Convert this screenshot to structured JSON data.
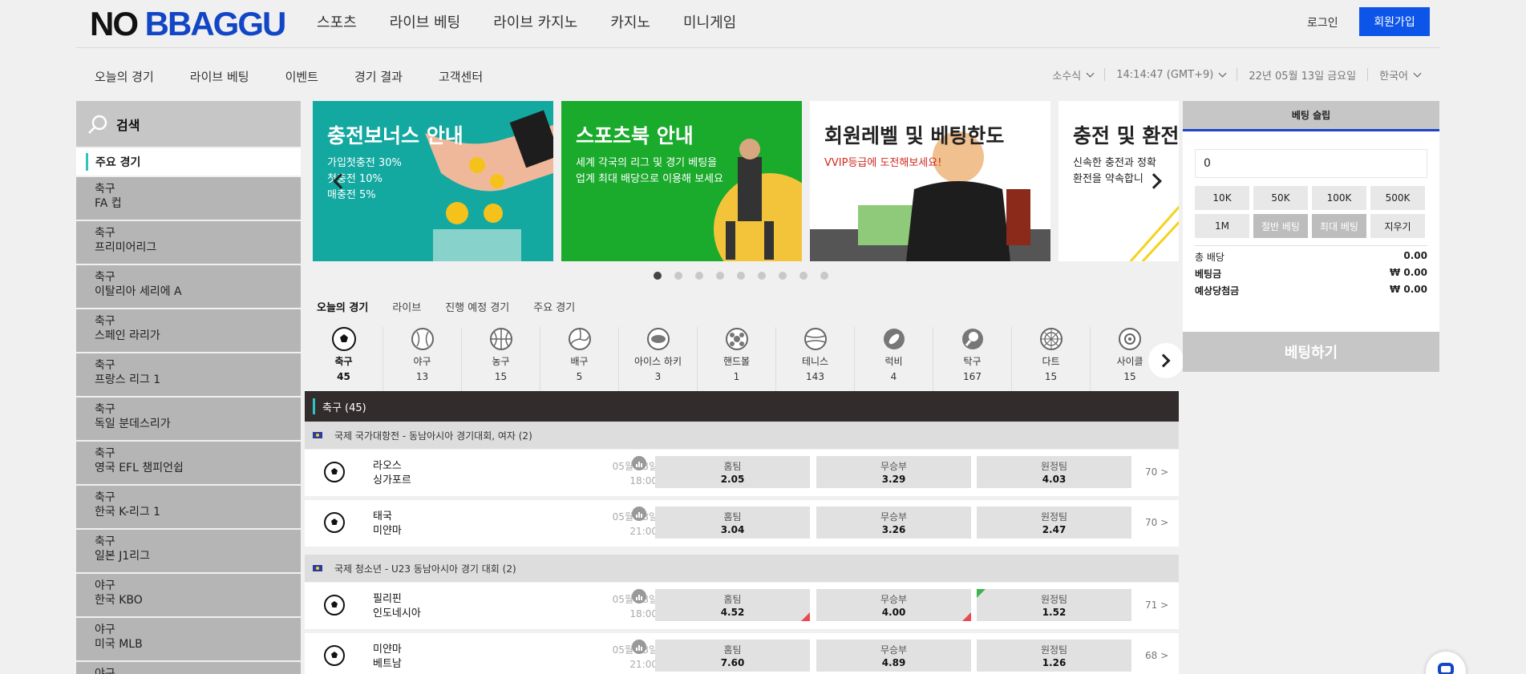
{
  "header": {
    "logo_part1": "NO",
    "logo_part2": "BBAGGU",
    "nav": [
      "스포츠",
      "라이브 베팅",
      "라이브 카지노",
      "카지노",
      "미니게임"
    ],
    "login": "로그인",
    "signup": "회원가입"
  },
  "subnav": {
    "items": [
      "오늘의 경기",
      "라이브 베팅",
      "이벤트",
      "경기 결과",
      "고객센터"
    ],
    "odds_format": "소수식",
    "time": "14:14:47 (GMT+9)",
    "date": "22년 05월 13일 금요일",
    "language": "한국어"
  },
  "sidebar": {
    "search": "검색",
    "title": "주요 경기",
    "items": [
      {
        "sport": "축구",
        "league": "FA 컵"
      },
      {
        "sport": "축구",
        "league": "프리미어리그"
      },
      {
        "sport": "축구",
        "league": "이탈리아 세리에 A"
      },
      {
        "sport": "축구",
        "league": "스페인 라리가"
      },
      {
        "sport": "축구",
        "league": "프랑스 리그 1"
      },
      {
        "sport": "축구",
        "league": "독일 분데스리가"
      },
      {
        "sport": "축구",
        "league": "영국 EFL 챔피언쉽"
      },
      {
        "sport": "축구",
        "league": "한국 K-리그 1"
      },
      {
        "sport": "축구",
        "league": "일본 J1리그"
      },
      {
        "sport": "야구",
        "league": "한국 KBO"
      },
      {
        "sport": "야구",
        "league": "미국 MLB"
      },
      {
        "sport": "야구",
        "league": ""
      }
    ]
  },
  "banners": [
    {
      "title": "충전보너스 안내",
      "lines": [
        "가입첫충전 30%",
        "첫충전 10%",
        "매충전 5%"
      ],
      "bg": "#13a8a0"
    },
    {
      "title": "스포츠북 안내",
      "lines": [
        "세계 각국의 리그 및 경기 베팅을",
        "업계 최대 배당으로 이용해 보세요"
      ],
      "bg": "#1aaa2c"
    },
    {
      "title": "회원레벨 및 베팅한도",
      "lines": [
        "VVIP등급에 도전해보세요!"
      ],
      "bg": "#ffffff"
    },
    {
      "title": "충전 및 환전",
      "lines": [
        "신속한 충전과 정확",
        "환전을 약속합니"
      ],
      "bg": "#ffffff"
    }
  ],
  "tabs": [
    "오늘의 경기",
    "라이브",
    "진행 예정 경기",
    "주요 경기"
  ],
  "sports": [
    {
      "name": "축구",
      "count": "45",
      "icon": "soccer-icon"
    },
    {
      "name": "야구",
      "count": "13",
      "icon": "baseball-icon"
    },
    {
      "name": "농구",
      "count": "15",
      "icon": "basketball-icon"
    },
    {
      "name": "배구",
      "count": "5",
      "icon": "volleyball-icon"
    },
    {
      "name": "아이스 하키",
      "count": "3",
      "icon": "hockey-icon"
    },
    {
      "name": "핸드볼",
      "count": "1",
      "icon": "handball-icon"
    },
    {
      "name": "테니스",
      "count": "143",
      "icon": "tennis-icon"
    },
    {
      "name": "럭비",
      "count": "4",
      "icon": "rugby-icon"
    },
    {
      "name": "탁구",
      "count": "167",
      "icon": "table-tennis-icon"
    },
    {
      "name": "다트",
      "count": "15",
      "icon": "darts-icon"
    },
    {
      "name": "사이클",
      "count": "15",
      "icon": "cycling-icon"
    }
  ],
  "section_title": "축구 (45)",
  "leagues": [
    {
      "name": "국제 국가대항전 - 동남아시아 경기대회, 여자 (2)",
      "matches": [
        {
          "home": "라오스",
          "away": "싱가포르",
          "date": "05월 13일",
          "time": "18:00",
          "odds": [
            "2.05",
            "3.29",
            "4.03"
          ],
          "more": "70 >"
        },
        {
          "home": "태국",
          "away": "미얀마",
          "date": "05월 13일",
          "time": "21:00",
          "odds": [
            "3.04",
            "3.26",
            "2.47"
          ],
          "more": "70 >"
        }
      ]
    },
    {
      "name": "국제 청소년 - U23 동남아시아 경기 대회 (2)",
      "matches": [
        {
          "home": "필리핀",
          "away": "인도네시아",
          "date": "05월 13일",
          "time": "18:00",
          "odds": [
            "4.52",
            "4.00",
            "1.52"
          ],
          "more": "71 >"
        },
        {
          "home": "미얀마",
          "away": "베트남",
          "date": "05월 13일",
          "time": "21:00",
          "odds": [
            "7.60",
            "4.89",
            "1.26"
          ],
          "more": "68 >"
        }
      ]
    }
  ],
  "odd_labels": [
    "홈팀",
    "무승부",
    "원정팀"
  ],
  "betslip": {
    "title": "베팅 슬립",
    "amount": "0",
    "buttons": [
      "10K",
      "50K",
      "100K",
      "500K",
      "1M",
      "절반 베팅",
      "최대 베팅",
      "지우기"
    ],
    "total_odds_label": "총 배당",
    "total_odds": "0.00",
    "stake_label": "베팅금",
    "stake": "₩ 0.00",
    "payout_label": "예상당첨금",
    "payout": "₩ 0.00",
    "place": "베팅하기"
  }
}
